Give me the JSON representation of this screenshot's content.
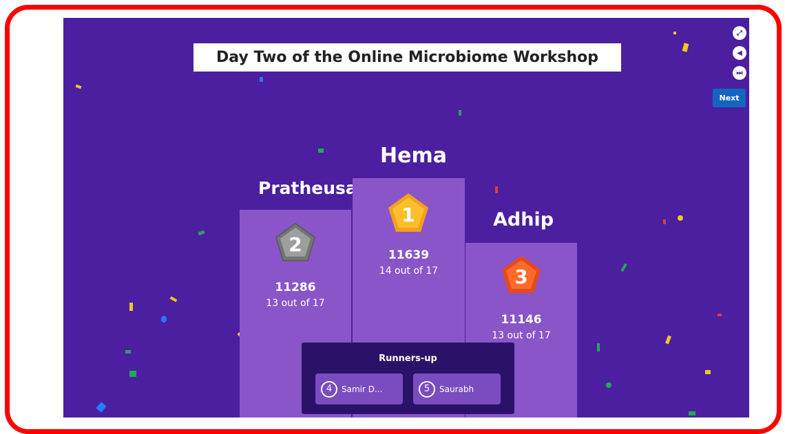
{
  "title": "Day Two of the Online Microbiome Workshop",
  "controls": {
    "next_label": "Next"
  },
  "podium": {
    "first": {
      "name": "Hema",
      "rank": "1",
      "score": "11639",
      "correct": "14 out of 17"
    },
    "second": {
      "name": "Pratheusa",
      "rank": "2",
      "score": "11286",
      "correct": "13 out of 17"
    },
    "third": {
      "name": "Adhip",
      "rank": "3",
      "score": "11146",
      "correct": "13 out of 17"
    }
  },
  "runners_up": {
    "title": "Runners-up",
    "items": [
      {
        "rank": "4",
        "name": "Samir D..."
      },
      {
        "rank": "5",
        "name": "Saurabh"
      }
    ]
  },
  "colors": {
    "background": "#4b1fa0",
    "podium": "#8a55c8",
    "gold": "#f5a623",
    "silver": "#8c8c8c",
    "bronze": "#f05a22",
    "frame": "#ff0000"
  }
}
